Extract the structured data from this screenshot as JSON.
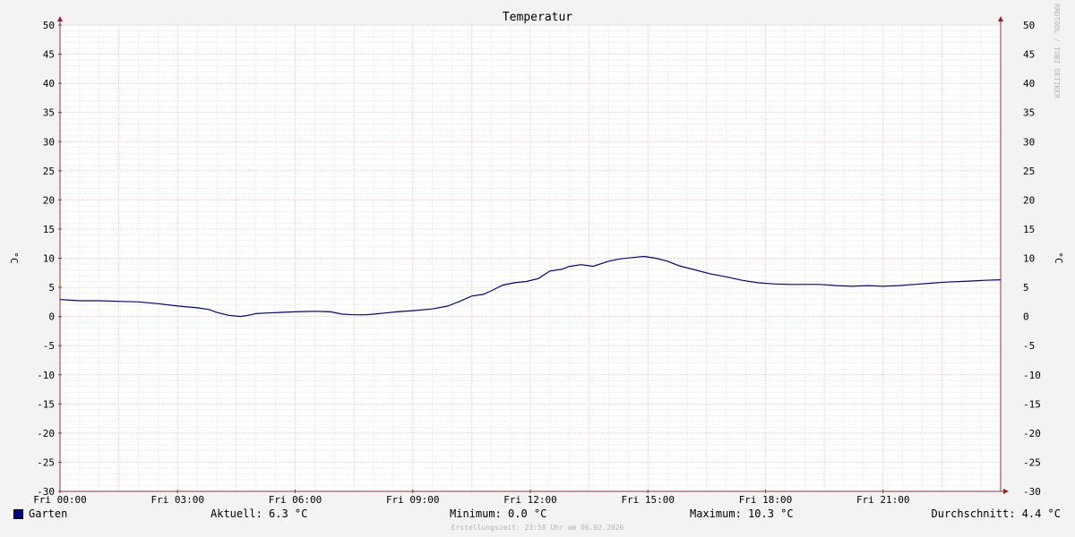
{
  "chart_data": {
    "type": "line",
    "title": "Temperatur",
    "ylabel": "°C",
    "y_ticks": [
      50,
      45,
      40,
      35,
      30,
      25,
      20,
      15,
      10,
      5,
      0,
      -5,
      -10,
      -15,
      -20,
      -25,
      -30
    ],
    "ylim": [
      -30,
      50
    ],
    "x_tick_labels": [
      "Fri 00:00",
      "Fri 03:00",
      "Fri 06:00",
      "Fri 09:00",
      "Fri 12:00",
      "Fri 15:00",
      "Fri 18:00",
      "Fri 21:00"
    ],
    "x_ticks_hours": [
      0,
      3,
      6,
      9,
      12,
      15,
      18,
      21
    ],
    "xlim_hours": [
      0,
      24
    ],
    "grid": true,
    "series": [
      {
        "name": "Garten",
        "color": "#00008b",
        "x_hours": [
          0,
          0.25,
          0.5,
          1,
          1.5,
          2,
          2.5,
          3,
          3.5,
          3.8,
          4,
          4.3,
          4.6,
          4.8,
          5,
          5.3,
          5.6,
          6,
          6.5,
          6.9,
          7.2,
          7.5,
          7.8,
          8,
          8.3,
          8.6,
          9,
          9.5,
          9.9,
          10.2,
          10.5,
          10.8,
          11,
          11.3,
          11.6,
          11.9,
          12.2,
          12.5,
          12.8,
          13,
          13.3,
          13.6,
          14,
          14.3,
          14.6,
          14.9,
          15.2,
          15.5,
          15.8,
          16.2,
          16.6,
          17,
          17.4,
          17.8,
          18.2,
          18.6,
          19,
          19.4,
          19.8,
          20.2,
          20.6,
          21,
          21.4,
          21.8,
          22.2,
          22.6,
          23,
          23.3,
          23.6,
          24
        ],
        "values": [
          2.9,
          2.8,
          2.7,
          2.7,
          2.6,
          2.5,
          2.2,
          1.8,
          1.5,
          1.2,
          0.7,
          0.2,
          0.0,
          0.2,
          0.5,
          0.6,
          0.7,
          0.8,
          0.9,
          0.8,
          0.4,
          0.3,
          0.3,
          0.4,
          0.6,
          0.8,
          1.0,
          1.3,
          1.8,
          2.6,
          3.5,
          3.8,
          4.4,
          5.4,
          5.8,
          6.0,
          6.5,
          7.8,
          8.1,
          8.6,
          8.9,
          8.6,
          9.5,
          9.9,
          10.1,
          10.3,
          10.0,
          9.5,
          8.7,
          8.0,
          7.3,
          6.8,
          6.2,
          5.8,
          5.6,
          5.5,
          5.5,
          5.5,
          5.3,
          5.2,
          5.3,
          5.2,
          5.3,
          5.5,
          5.7,
          5.9,
          6.0,
          6.1,
          6.2,
          6.3
        ]
      }
    ]
  },
  "legend": {
    "series_label": "Garten",
    "swatch_color": "#00008b",
    "aktuell": "Aktuell: 6.3 °C",
    "minimum": "Minimum: 0.0 °C",
    "maximum": "Maximum: 10.3 °C",
    "durchschnitt": "Durchschnitt: 4.4 °C"
  },
  "footer": "Erstellungszeit: 23:58 Uhr am 06.02.2026",
  "credit": "RRDTOOL / TOBI OETIKER"
}
